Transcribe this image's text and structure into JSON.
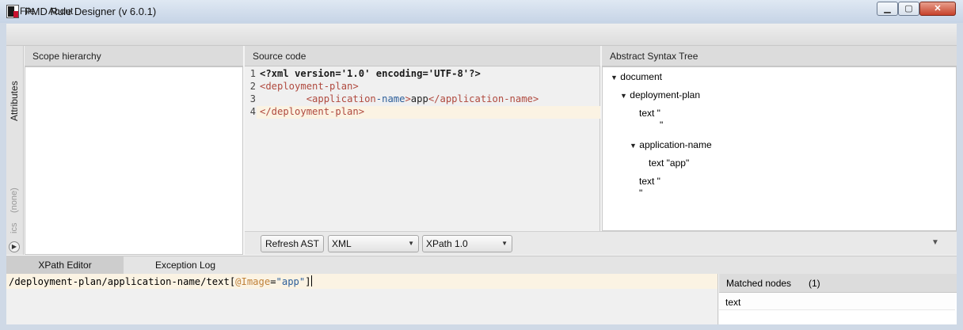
{
  "window": {
    "title": "PMD Rule Designer (v 6.0.1)"
  },
  "window_controls": {
    "minimize": "▁",
    "maximize": "▢",
    "close": "✕"
  },
  "menu": {
    "items": [
      "File",
      "About"
    ]
  },
  "side_tabs": {
    "attributes": "Attributes",
    "none": "(none)",
    "partial": "ics"
  },
  "panes": {
    "scope": {
      "title": "Scope hierarchy"
    },
    "source": {
      "title": "Source code"
    },
    "ast": {
      "title": "Abstract Syntax Tree"
    }
  },
  "source_code": {
    "line_numbers": [
      "1",
      "2",
      "3",
      "4"
    ],
    "line1": "<?xml version='1.0' encoding='UTF-8'?>",
    "line2": "<deployment-plan>",
    "line3_indent": "        ",
    "line3_open_a": "<application",
    "line3_open_b": "-name",
    "line3_open_c": ">",
    "line3_text": "app",
    "line3_close": "</application-name>",
    "line4": "</deployment-plan>"
  },
  "ast_tree": {
    "document": "document",
    "deployment_plan": "deployment-plan",
    "text1_a": "text \"",
    "text1_b": "\"",
    "application_name": "application-name",
    "text_app": "text \"app\"",
    "text2_a": "text \"",
    "text2_b": "\""
  },
  "toolbar": {
    "refresh_label": "Refresh AST",
    "language_value": "XML",
    "xpath_version_value": "XPath 1.0"
  },
  "bottom_tabs": {
    "xpath_editor": "XPath Editor",
    "exception_log": "Exception Log"
  },
  "xpath": {
    "p1": "/deployment-plan/application-name/text[",
    "attr": "@Image",
    "eq": "=",
    "str": "\"app\"",
    "close": "]"
  },
  "matched_nodes": {
    "label": "Matched nodes",
    "count": "(1)",
    "items": [
      "text"
    ]
  },
  "colors": {
    "tag": "#b04a3f",
    "attr_blue": "#2d5f9a",
    "line_highlight": "#fbf3e3",
    "xpath_attr": "#c0823a"
  }
}
